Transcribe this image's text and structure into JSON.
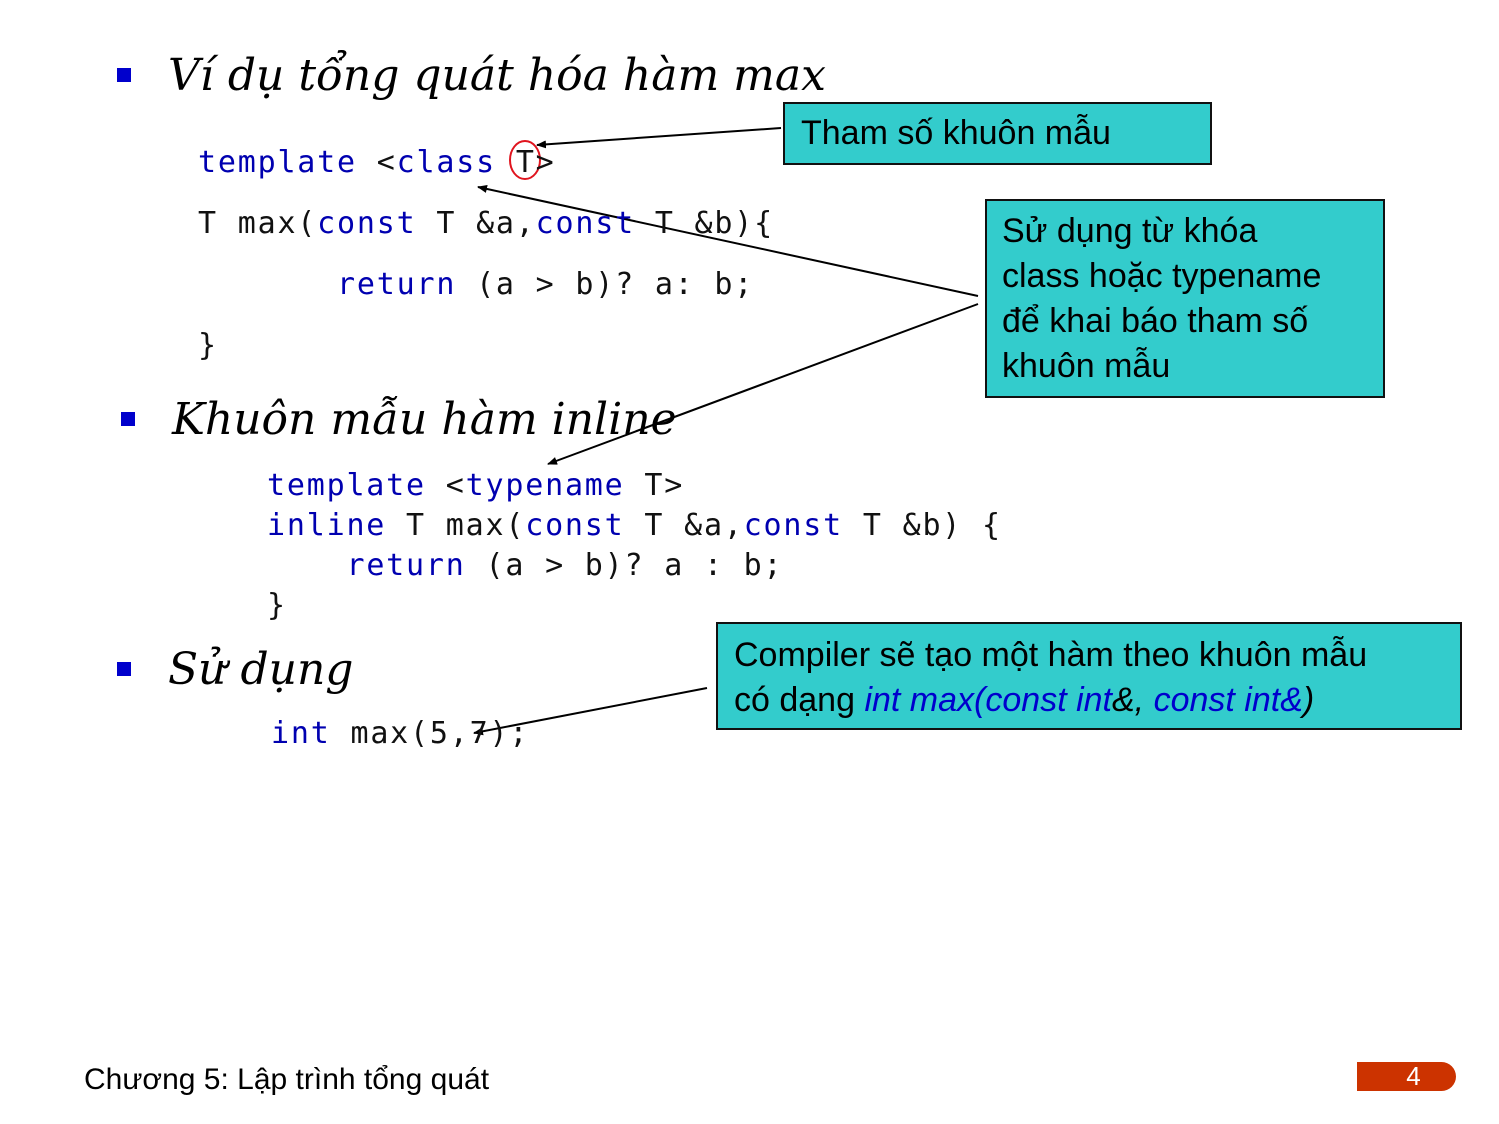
{
  "slide": {
    "footer_title": "Chương 5: Lập trình tổng quát",
    "page_number": "4",
    "colors": {
      "bullet": "#0000cc",
      "keyword": "#0000b0",
      "callout_bg": "#33cccc",
      "page_badge": "#cc3300",
      "highlight_circle": "#e0141e"
    }
  },
  "sections": [
    {
      "heading": "Ví dụ tổng quát hóa hàm max",
      "code": [
        [
          {
            "t": "template",
            "kw": true
          },
          {
            "t": " <",
            "kw": false
          },
          {
            "t": "class",
            "kw": true
          },
          {
            "t": " T>",
            "kw": false
          }
        ],
        [
          {
            "t": "T max(",
            "kw": false
          },
          {
            "t": "const",
            "kw": true
          },
          {
            "t": " T &a,",
            "kw": false
          },
          {
            "t": "const",
            "kw": true
          },
          {
            "t": " T &b){",
            "kw": false
          }
        ],
        [
          {
            "t": "       ",
            "kw": false
          },
          {
            "t": "return",
            "kw": true
          },
          {
            "t": " (a > b)? a: b;",
            "kw": false
          }
        ],
        [
          {
            "t": "}",
            "kw": false
          }
        ]
      ]
    },
    {
      "heading": "Khuôn mẫu hàm inline",
      "code": [
        [
          {
            "t": "template",
            "kw": true
          },
          {
            "t": " <",
            "kw": false
          },
          {
            "t": "typename",
            "kw": true
          },
          {
            "t": " T>",
            "kw": false
          }
        ],
        [
          {
            "t": "inline",
            "kw": true
          },
          {
            "t": " T max(",
            "kw": false
          },
          {
            "t": "const",
            "kw": true
          },
          {
            "t": " T &a,",
            "kw": false
          },
          {
            "t": "const",
            "kw": true
          },
          {
            "t": " T &b) {",
            "kw": false
          }
        ],
        [
          {
            "t": "    ",
            "kw": false
          },
          {
            "t": "return",
            "kw": true
          },
          {
            "t": " (a > b)? a : b;",
            "kw": false
          }
        ],
        [
          {
            "t": "}",
            "kw": false
          }
        ]
      ]
    },
    {
      "heading": "Sử dụng",
      "code": [
        [
          {
            "t": "int",
            "kw": true
          },
          {
            "t": " max(5,7);",
            "kw": false
          }
        ]
      ]
    }
  ],
  "callouts": {
    "template_param": "Tham số khuôn mẫu",
    "keyword_usage": [
      "Sử dụng từ khóa",
      "class hoặc typename",
      "để khai báo tham số",
      "khuôn mẫu"
    ],
    "compiler": {
      "line1": "Compiler sẽ tạo một hàm theo khuôn mẫu",
      "line2_prefix": "có dạng ",
      "line2_parts": [
        {
          "t": "int max(",
          "blue": true
        },
        {
          "t": "const int",
          "blue": true
        },
        {
          "t": "&, ",
          "blue": false
        },
        {
          "t": "const int&",
          "blue": true
        },
        {
          "t": ")",
          "blue": false
        }
      ]
    }
  }
}
